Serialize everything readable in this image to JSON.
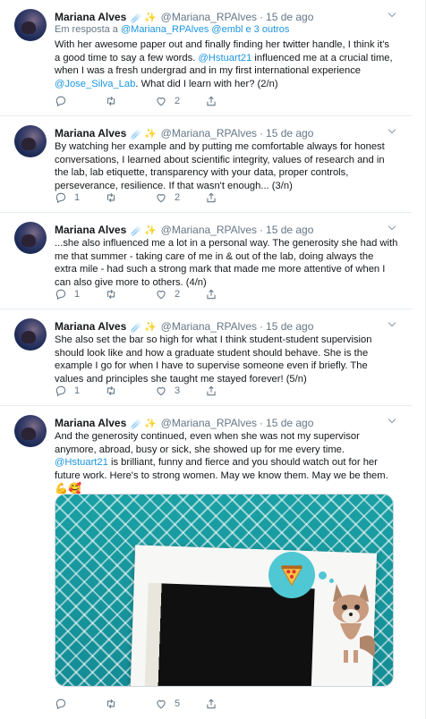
{
  "author": {
    "name": "Mariana Alves",
    "emojis": "☄️✨",
    "handle": "@Mariana_RPAlves",
    "sep": "·"
  },
  "colors": {
    "link": "#1b95e0",
    "muted": "#657786",
    "divider": "#e6ecf0"
  },
  "tweets": [
    {
      "date": "15 de ago",
      "reply_prefix": "Em resposta a ",
      "reply_links": "@Mariana_RPAlves @embl e 3 outros",
      "lines": [
        "With her awesome paper out and finally finding her twitter handle, I think it's",
        "a good time to say a few words.  ",
        "when I was a fresh undergrad and in my first international experience",
        ". What did I learn with her? (2/n)"
      ],
      "mention1": "@Hstuart21",
      "line2_tail": " influenced me at a crucial time,",
      "mention2": "@Jose_Silva_Lab",
      "reply_count": "",
      "retweet_count": "",
      "like_count": "2"
    },
    {
      "date": "15 de ago",
      "lines": [
        "By watching her example and by putting me comfortable always for honest",
        "conversations, I learned about scientific integrity, values of research and in",
        "the lab, lab etiquette, transparency with your data, proper controls,",
        "perseverance, resilience. If that wasn't enough... (3/n)"
      ],
      "reply_count": "1",
      "retweet_count": "",
      "like_count": "2"
    },
    {
      "date": "15 de ago",
      "lines": [
        "...she also influenced me a lot in a personal way. The generosity she had with",
        "me that summer - taking care of me in & out of the lab, doing always the",
        "extra mile - had such a strong mark that made me more attentive of when I",
        "can also give more to others. (4/n)"
      ],
      "reply_count": "1",
      "retweet_count": "",
      "like_count": "2"
    },
    {
      "date": "15 de ago",
      "lines": [
        "She also set the bar so high for what I think student-student supervision",
        "should look like and how a graduate student should behave. She is the",
        "example I go for when I have to supervise someone even if briefly. The",
        "values and principles she taught me stayed forever! (5/n)"
      ],
      "reply_count": "1",
      "retweet_count": "",
      "like_count": "3"
    },
    {
      "date": "15 de ago",
      "lines": [
        "And the generosity continued, even when she was not my supervisor",
        "anymore, abroad, busy or sick, she showed up for me every time.",
        " is brilliant, funny and fierce and you should watch out for her",
        "future work. Here's to strong women. May we know them. May we be them.",
        "💪🥰"
      ],
      "mention1": "@Hstuart21",
      "reply_count": "",
      "retweet_count": "",
      "like_count": "5"
    }
  ]
}
